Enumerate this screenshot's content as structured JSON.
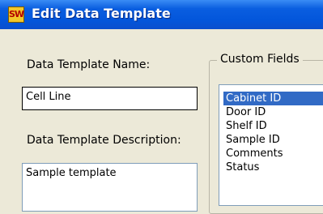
{
  "window": {
    "title": "Edit Data Template",
    "icon": "sw-app-icon",
    "icon_text": "SW"
  },
  "form": {
    "name_label": "Data Template Name:",
    "name_value": "Cell Line",
    "description_label": "Data Template Description:",
    "description_value": "Sample template"
  },
  "custom_fields": {
    "legend": "Custom Fields",
    "items": [
      "Cabinet ID",
      "Door ID",
      "Shelf ID",
      "Sample ID",
      "Comments",
      "Status"
    ],
    "selected": "Cabinet ID"
  },
  "colors": {
    "titlebar": "#0356db",
    "selection": "#316ac5",
    "dialog_bg": "#ece9d8"
  }
}
